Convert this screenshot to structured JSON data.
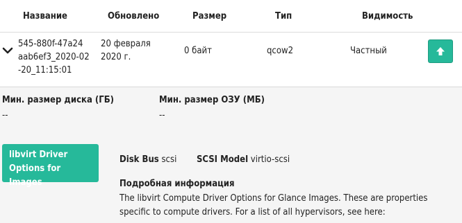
{
  "table": {
    "headers": [
      "Название",
      "Обновлено",
      "Размер",
      "Тип",
      "Видимость"
    ],
    "row": {
      "name_lines": [
        "545-880f-47a24",
        "aab6ef3_2020-02",
        "-20_11:15:01"
      ],
      "updated_lines": [
        "20 февраля",
        "2020 г."
      ],
      "size": "0 байт",
      "type": "qcow2",
      "visibility": "Частный"
    }
  },
  "details": {
    "min_disk_label": "Мин. размер диска (ГБ)",
    "min_disk_value": "--",
    "min_ram_label": "Мин. размер ОЗУ (МБ)",
    "min_ram_value": "--",
    "libvirt_button_lines": [
      "libvirt Driver",
      "Options for Images"
    ],
    "disk_bus_label": "Disk Bus",
    "disk_bus_value": "scsi",
    "scsi_model_label": "SCSI Model",
    "scsi_model_value": "virtio-scsi",
    "detail_heading": "Подробная информация",
    "description": "The libvirt Compute Driver Options for Glance Images. These are properties specific to compute drivers. For a list of all hypervisors, see here:"
  },
  "icons": {
    "expand": "chevron-down-icon",
    "upload": "arrow-up-icon"
  },
  "colors": {
    "accent": "#26b99a",
    "details_bg": "#f5f5f5"
  }
}
